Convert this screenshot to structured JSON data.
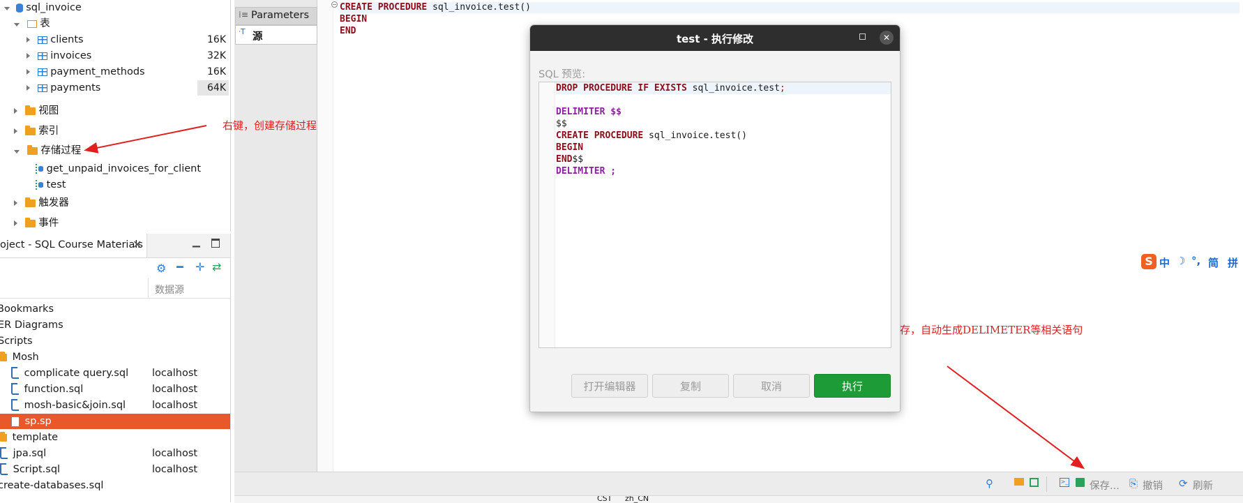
{
  "db_tree": {
    "root": "sql_invoice",
    "tables_folder": "表",
    "tables": [
      {
        "name": "clients",
        "size": "16K"
      },
      {
        "name": "invoices",
        "size": "32K"
      },
      {
        "name": "payment_methods",
        "size": "16K"
      },
      {
        "name": "payments",
        "size": "64K"
      }
    ],
    "views_folder": "视图",
    "indexes_folder": "索引",
    "procedures_folder": "存储过程",
    "procedures": [
      "get_unpaid_invoices_for_client",
      "test"
    ],
    "triggers_folder": "触发器",
    "events_folder": "事件"
  },
  "project_panel": {
    "tab_title": "oject - SQL Course Materials",
    "column_header": "数据源",
    "items": [
      {
        "label": "Bookmarks",
        "source": ""
      },
      {
        "label": "ER Diagrams",
        "source": ""
      },
      {
        "label": "Scripts",
        "source": ""
      },
      {
        "label": "Mosh",
        "source": ""
      },
      {
        "label": "complicate query.sql",
        "source": "localhost"
      },
      {
        "label": "function.sql",
        "source": "localhost"
      },
      {
        "label": "mosh-basic&join.sql",
        "source": "localhost"
      },
      {
        "label": "sp.sp",
        "source": ""
      },
      {
        "label": "template",
        "source": ""
      },
      {
        "label": "jpa.sql",
        "source": "localhost"
      },
      {
        "label": "Script.sql",
        "source": "localhost"
      },
      {
        "label": "create-databases.sql",
        "source": ""
      }
    ]
  },
  "side_tabs": {
    "parameters": "Parameters",
    "source": "源"
  },
  "editor": {
    "line1_kw": "CREATE PROCEDURE",
    "line1_rest": " sql_invoice.test()",
    "line2": "BEGIN",
    "line3": "END"
  },
  "dialog": {
    "title": "test - 执行修改",
    "preview_label": "SQL 预览:",
    "sql": {
      "l1_kw": "DROP PROCEDURE IF EXISTS",
      "l1_rest": " sql_invoice.test",
      "l1_semi": ";",
      "l3": "DELIMITER $$",
      "l4": "$$",
      "l5_kw": "CREATE PROCEDURE",
      "l5_rest": " sql_invoice.test()",
      "l6": "BEGIN",
      "l7_kw": "END",
      "l7_rest": "$$",
      "l8": "DELIMITER ;"
    },
    "buttons": {
      "open_editor": "打开编辑器",
      "copy": "复制",
      "cancel": "取消",
      "execute": "执行"
    }
  },
  "annotations": {
    "right_click": "右键，创建存储过程",
    "save_hint": "点击保存，自动生成DELIMETER等相关语句"
  },
  "toolbar": {
    "save": "保存...",
    "undo": "撤销",
    "refresh": "刷新"
  },
  "status": {
    "s1": "CST",
    "s2": "zh_CN"
  },
  "ime": {
    "zh": "中",
    "moon": "☽",
    "punct": "°,",
    "jian": "简",
    "pin": "拼"
  },
  "colors": {
    "selected_row": "#e8582a",
    "execute_button": "#1c9b36",
    "annotation": "#e02020",
    "dialog_titlebar": "#2e2e2e"
  }
}
